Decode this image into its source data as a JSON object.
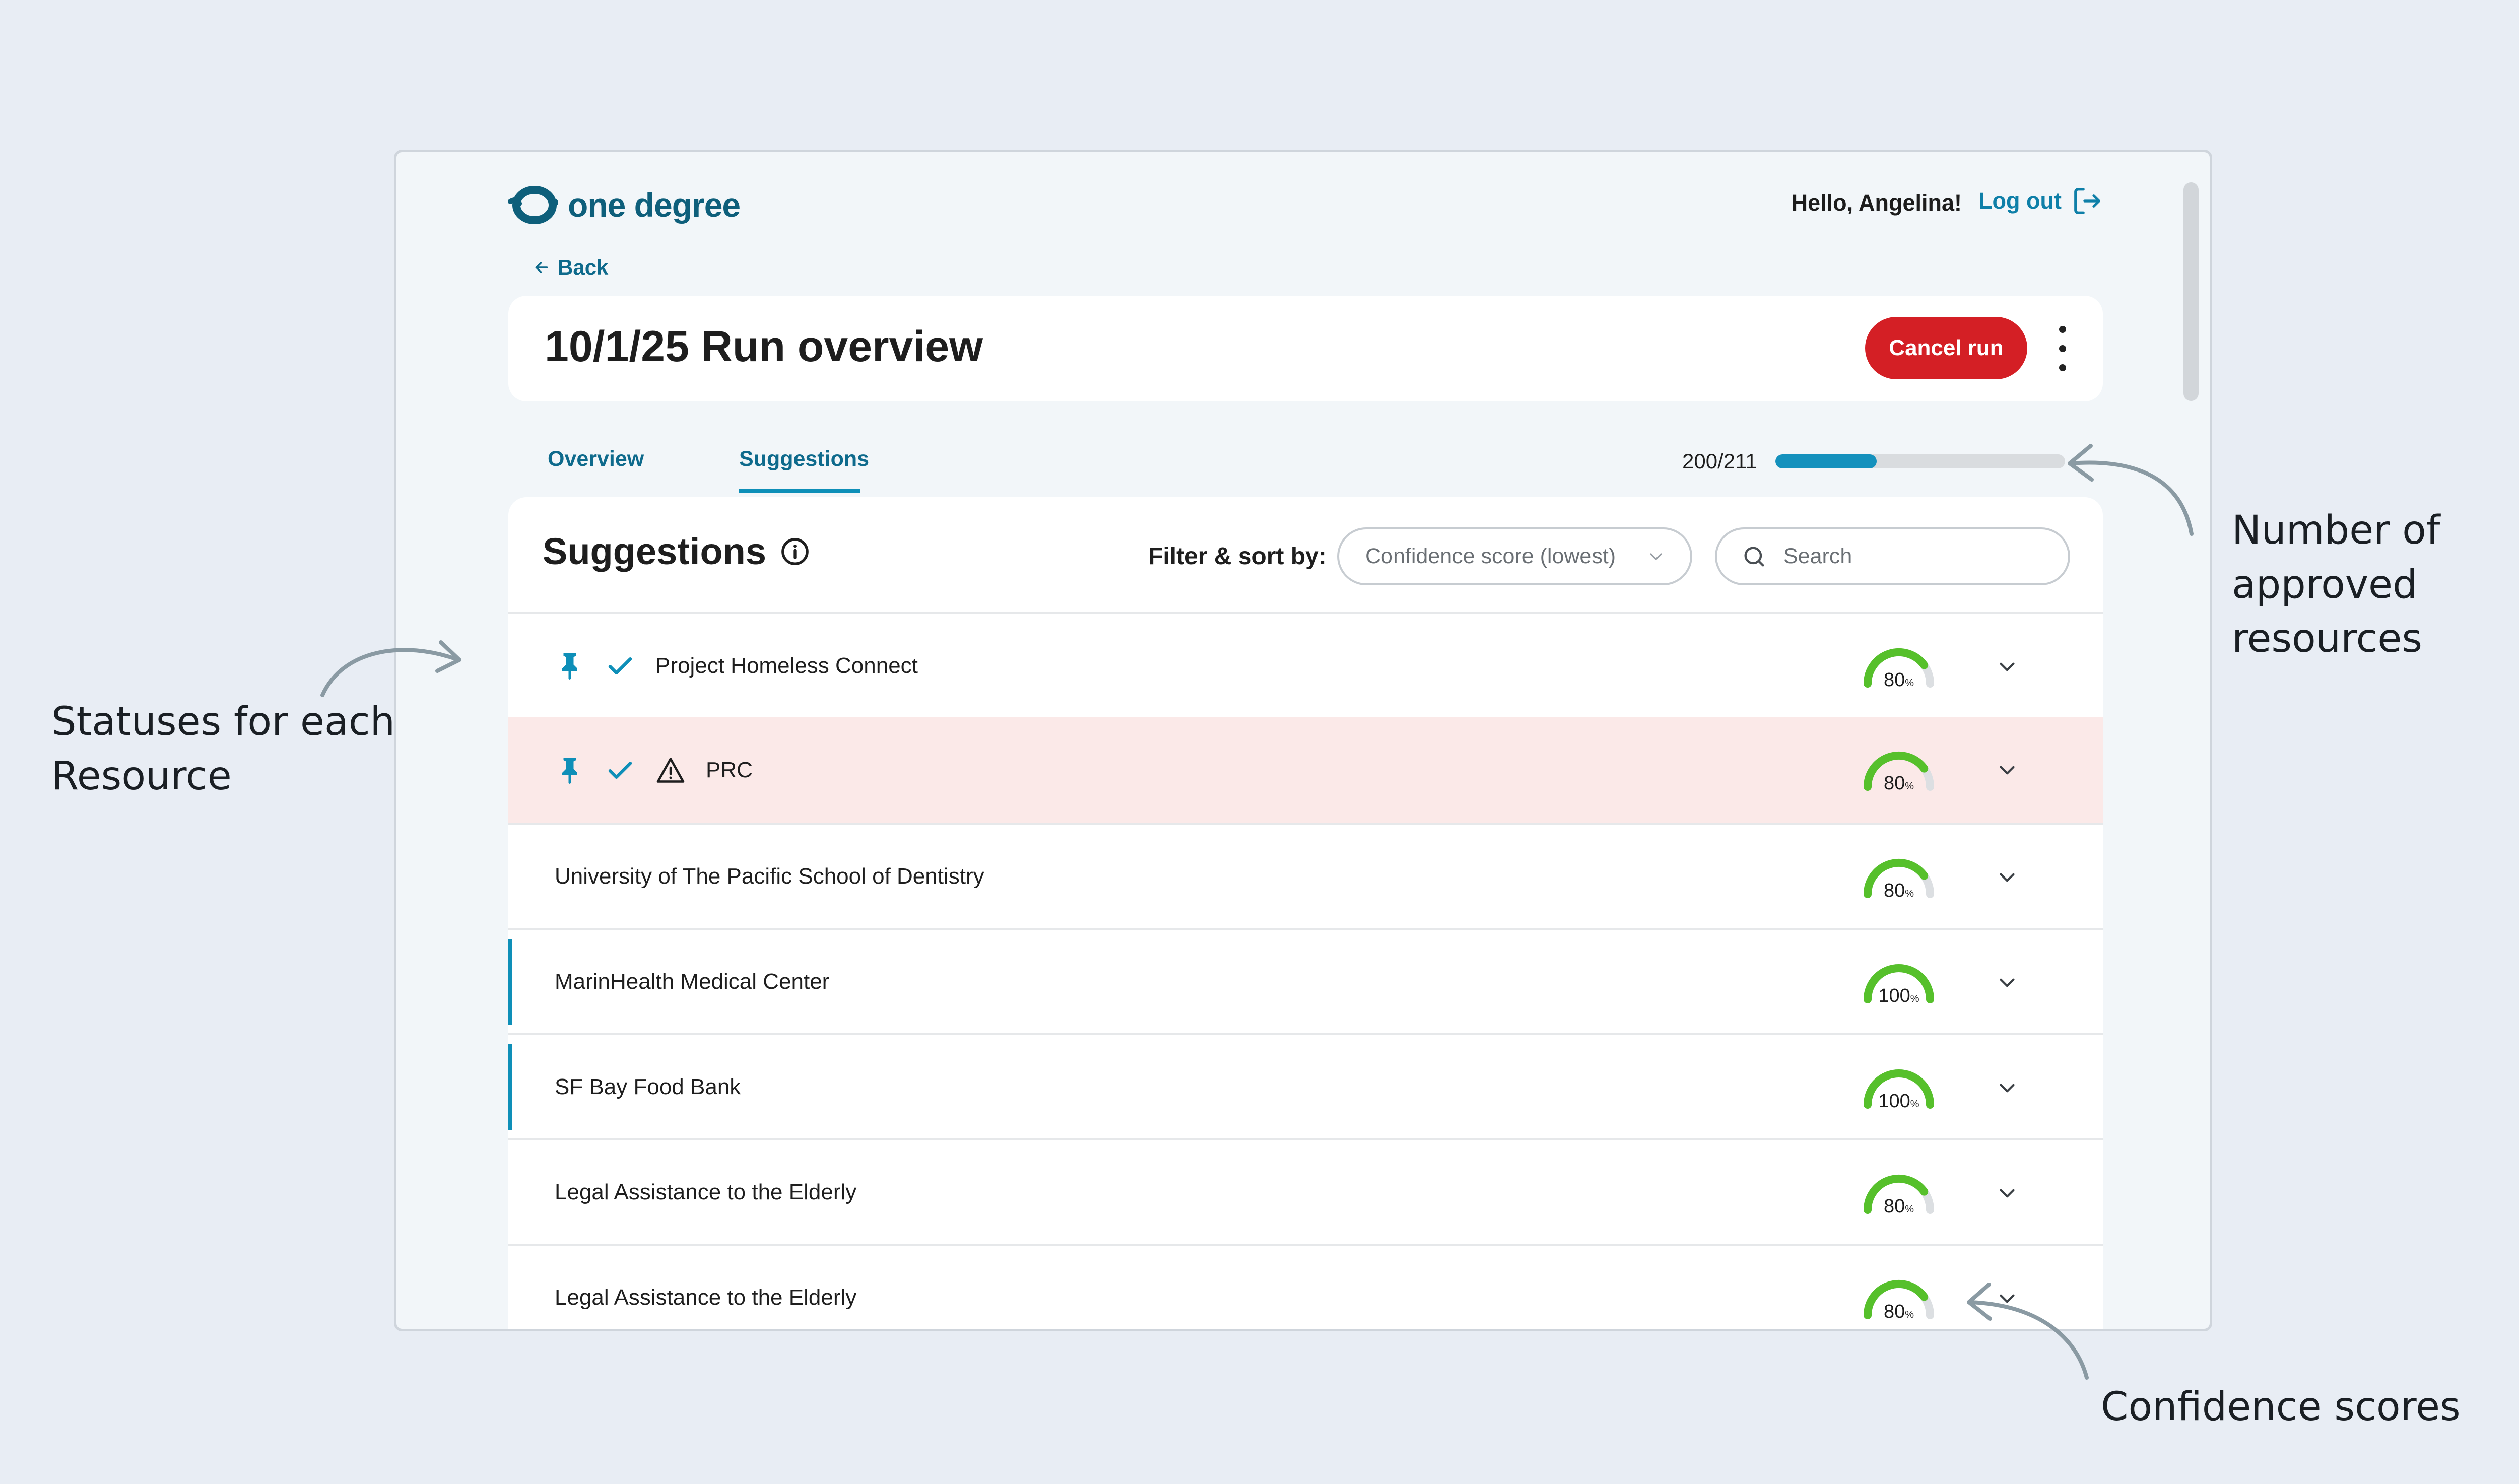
{
  "app": {
    "logo_text": "one degree",
    "greeting": "Hello, Angelina!",
    "logout_label": "Log out",
    "back_label": "Back"
  },
  "header": {
    "title": "10/1/25 Run overview",
    "cancel_label": "Cancel run"
  },
  "tabs": [
    {
      "label": "Overview",
      "active": false
    },
    {
      "label": "Suggestions",
      "active": true
    }
  ],
  "progress": {
    "label": "200/211",
    "approved": 200,
    "total": 211,
    "fill_fraction": 0.35
  },
  "suggestions": {
    "title": "Suggestions",
    "filter_label": "Filter & sort by:",
    "filter_value": "Confidence score (lowest)",
    "search_placeholder": "Search",
    "rows": [
      {
        "name": "Project Homeless Connect",
        "score": "80",
        "pinned": true,
        "approved": true,
        "warning": false
      },
      {
        "name": "PRC",
        "score": "80",
        "pinned": true,
        "approved": true,
        "warning": true
      },
      {
        "name": "University of The Pacific School of Dentistry",
        "score": "80",
        "pinned": false,
        "approved": false,
        "warning": false
      },
      {
        "name": "MarinHealth Medical Center",
        "score": "100",
        "pinned": false,
        "approved": false,
        "warning": false
      },
      {
        "name": "SF Bay Food Bank",
        "score": "100",
        "pinned": false,
        "approved": false,
        "warning": false
      },
      {
        "name": "Legal Assistance to the Elderly",
        "score": "80",
        "pinned": false,
        "approved": false,
        "warning": false
      },
      {
        "name": "Legal Assistance to the Elderly",
        "score": "80",
        "pinned": false,
        "approved": false,
        "warning": false
      }
    ]
  },
  "annotations": {
    "statuses_line1": "Statuses for each",
    "statuses_line2": "Resource",
    "approved_line1": "Number of approved",
    "approved_line2": "resources",
    "confidence": "Confidence scores"
  },
  "colors": {
    "brand": "#0e5f7b",
    "accent": "#1491bd",
    "danger": "#d41f25",
    "warning_row": "#fbe9e8",
    "gauge_green": "#56c02b"
  }
}
